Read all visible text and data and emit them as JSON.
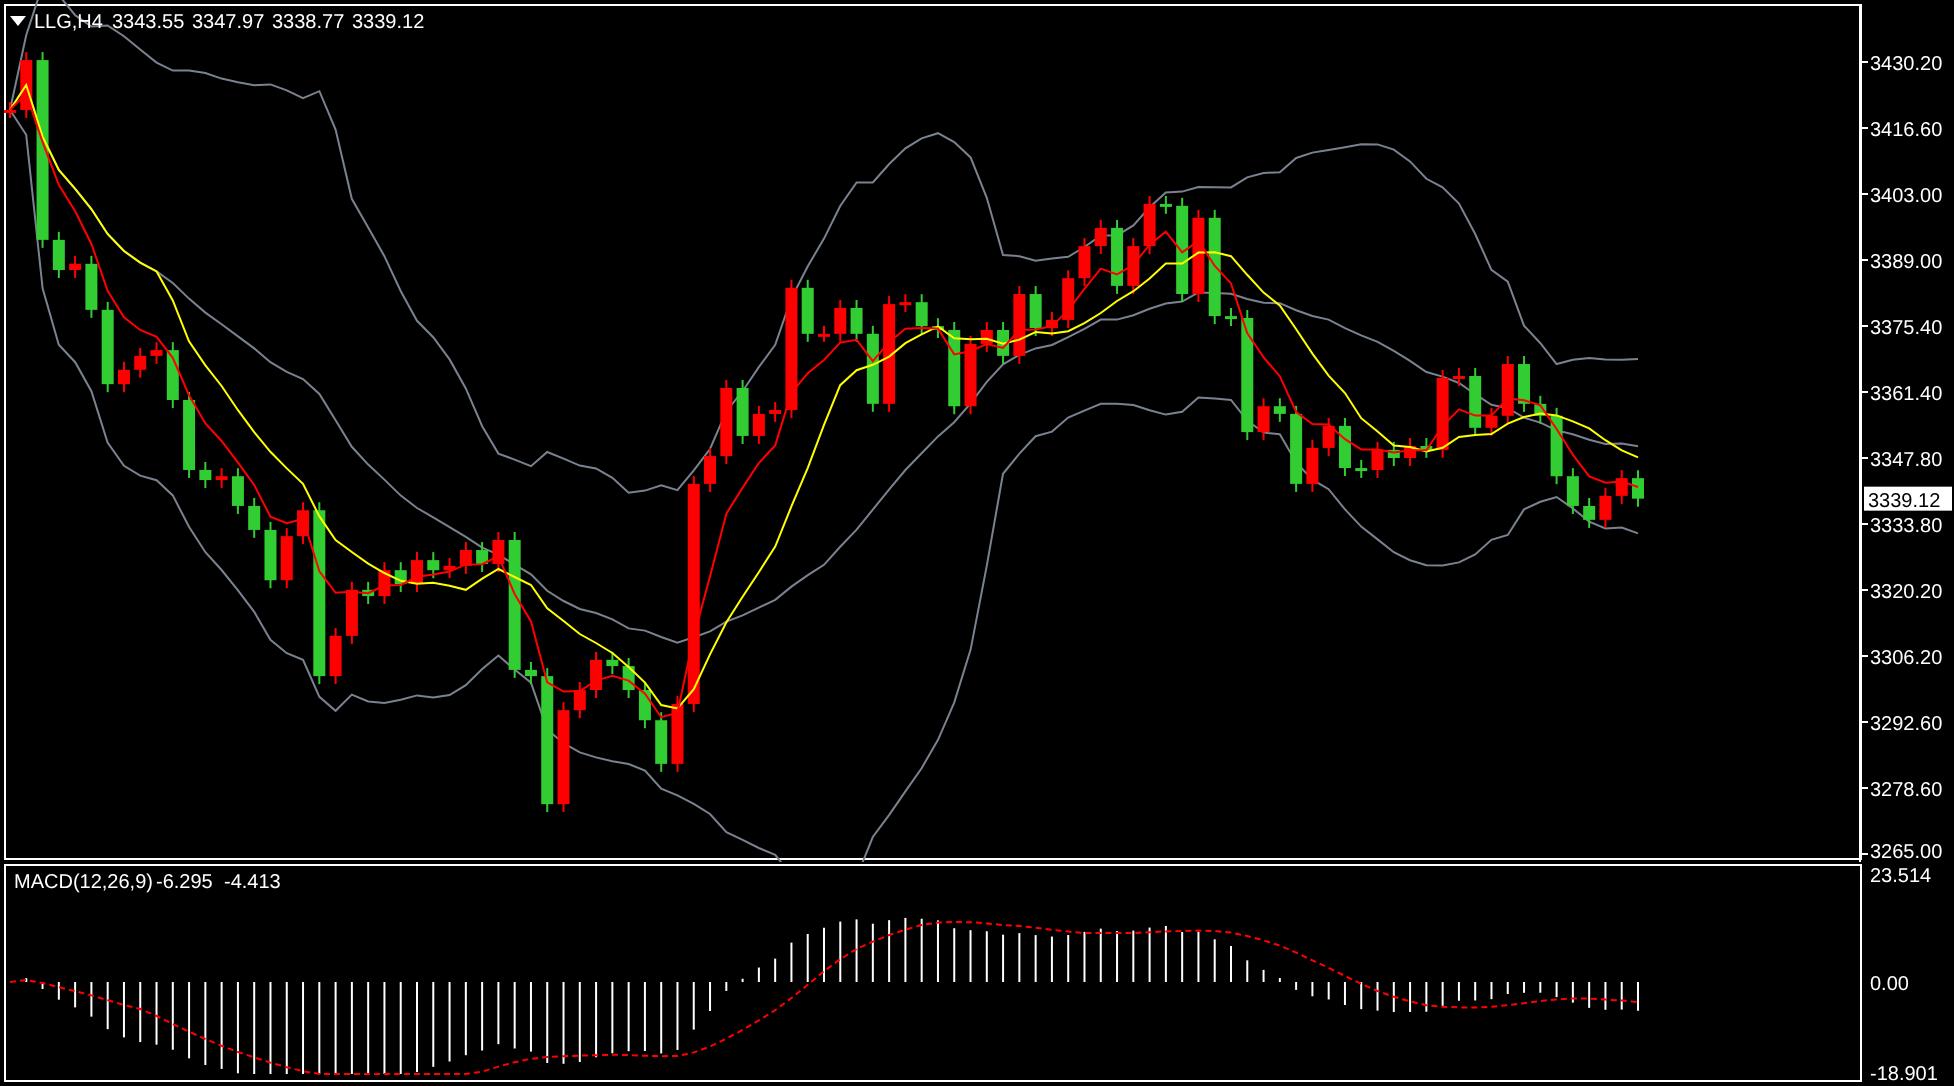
{
  "chart_header": {
    "symbol": "LLG,H4",
    "open": "3343.55",
    "high": "3347.97",
    "low": "3338.77",
    "close": "3339.12"
  },
  "main_chart": {
    "current_price": "3339.12",
    "price_axis_labels": [
      "3430.20",
      "3416.60",
      "3403.00",
      "3389.00",
      "3375.40",
      "3361.40",
      "3347.80",
      "3333.80",
      "3320.20",
      "3306.20",
      "3292.60",
      "3278.60",
      "3265.00"
    ]
  },
  "macd_panel": {
    "label": "MACD(12,26,9)",
    "macd_value": "-6.295",
    "signal_value": "-4.413",
    "axis_labels": [
      "23.514",
      "0.00",
      "-18.901"
    ]
  }
}
